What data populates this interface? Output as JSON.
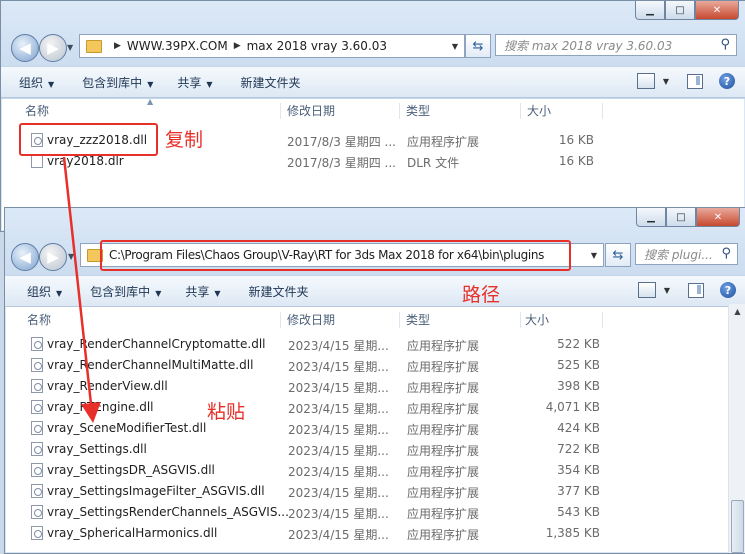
{
  "top_window": {
    "breadcrumbs": [
      "WWW.39PX.COM",
      "max 2018 vray 3.60.03"
    ],
    "search_placeholder": "搜索 max 2018 vray 3.60.03",
    "toolbar": {
      "organize": "组织",
      "include_library": "包含到库中",
      "share": "共享",
      "new_folder": "新建文件夹"
    },
    "columns": {
      "name": "名称",
      "date": "修改日期",
      "type": "类型",
      "size": "大小"
    },
    "files": [
      {
        "name": "vray_zzz2018.dll",
        "date": "2017/8/3 星期四 ...",
        "type": "应用程序扩展",
        "size": "16 KB",
        "icon": "dll-file-icon"
      },
      {
        "name": "vray2018.dlr",
        "date": "2017/8/3 星期四 ...",
        "type": "DLR 文件",
        "size": "16 KB",
        "icon": "blank-file-icon"
      }
    ]
  },
  "bottom_window": {
    "address": "C:\\Program Files\\Chaos Group\\V-Ray\\RT for 3ds Max 2018 for x64\\bin\\plugins",
    "search_placeholder": "搜索 plugi...",
    "toolbar": {
      "organize": "组织",
      "include_library": "包含到库中",
      "share": "共享",
      "new_folder": "新建文件夹"
    },
    "columns": {
      "name": "名称",
      "date": "修改日期",
      "type": "类型",
      "size": "大小"
    },
    "files": [
      {
        "name": "vray_RenderChannelCryptomatte.dll",
        "date": "2023/4/15 星期...",
        "type": "应用程序扩展",
        "size": "522 KB"
      },
      {
        "name": "vray_RenderChannelMultiMatte.dll",
        "date": "2023/4/15 星期...",
        "type": "应用程序扩展",
        "size": "525 KB"
      },
      {
        "name": "vray_RenderView.dll",
        "date": "2023/4/15 星期...",
        "type": "应用程序扩展",
        "size": "398 KB"
      },
      {
        "name": "vray_RTEngine.dll",
        "date": "2023/4/15 星期...",
        "type": "应用程序扩展",
        "size": "4,071 KB"
      },
      {
        "name": "vray_SceneModifierTest.dll",
        "date": "2023/4/15 星期...",
        "type": "应用程序扩展",
        "size": "424 KB"
      },
      {
        "name": "vray_Settings.dll",
        "date": "2023/4/15 星期...",
        "type": "应用程序扩展",
        "size": "722 KB"
      },
      {
        "name": "vray_SettingsDR_ASGVIS.dll",
        "date": "2023/4/15 星期...",
        "type": "应用程序扩展",
        "size": "354 KB"
      },
      {
        "name": "vray_SettingsImageFilter_ASGVIS.dll",
        "date": "2023/4/15 星期...",
        "type": "应用程序扩展",
        "size": "377 KB"
      },
      {
        "name": "vray_SettingsRenderChannels_ASGVIS...",
        "date": "2023/4/15 星期...",
        "type": "应用程序扩展",
        "size": "543 KB"
      },
      {
        "name": "vray_SphericalHarmonics.dll",
        "date": "2023/4/15 星期...",
        "type": "应用程序扩展",
        "size": "1,385 KB"
      }
    ]
  },
  "annotations": {
    "copy": "复制",
    "path": "路径",
    "paste": "粘贴"
  },
  "colors": {
    "annotation_red": "#e8302a"
  },
  "icons": {
    "back": "back-arrow-icon",
    "forward": "forward-arrow-icon",
    "folder": "folder-icon",
    "refresh": "refresh-icon",
    "search": "search-icon",
    "help": "help-icon"
  }
}
